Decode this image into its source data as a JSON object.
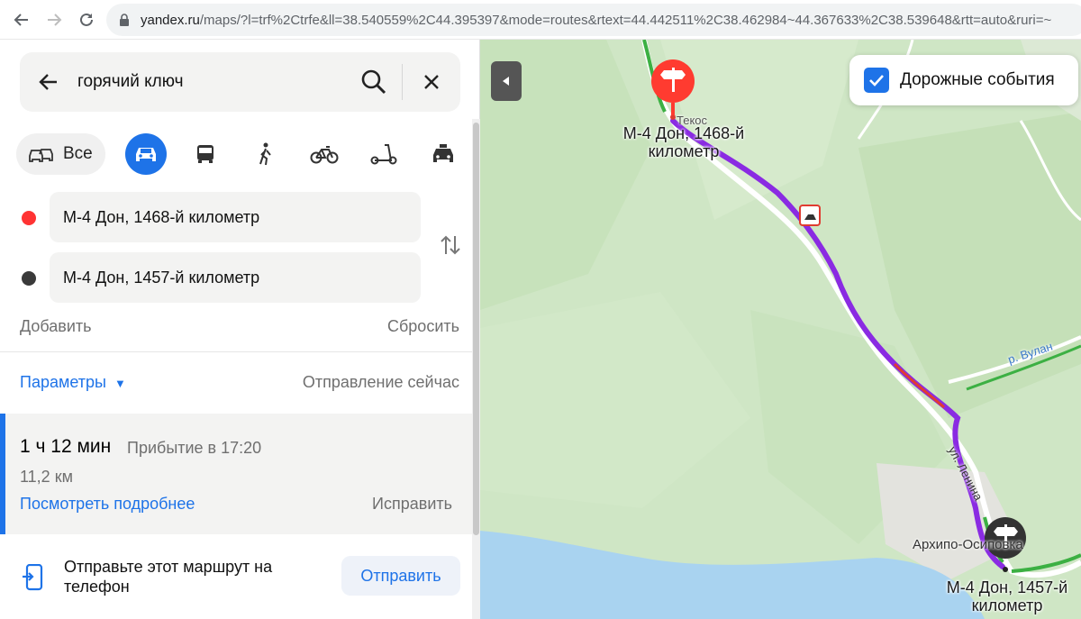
{
  "browser": {
    "url_domain": "yandex.ru",
    "url_rest": "/maps/?l=trf%2Ctrfe&ll=38.540559%2C44.395397&mode=routes&rtext=44.442511%2C38.462984~44.367633%2C38.539648&rtt=auto&ruri=~"
  },
  "search": {
    "query": "горячий ключ"
  },
  "modes": {
    "all_label": "Все",
    "items": [
      "car",
      "bus",
      "walk",
      "bicycle",
      "scooter",
      "taxi"
    ],
    "active": "car"
  },
  "points": {
    "start": "М-4 Дон, 1468-й километр",
    "end": "М-4 Дон, 1457-й километр",
    "start_color": "#ff3333",
    "end_color": "#3a3a3a"
  },
  "actions": {
    "add": "Добавить",
    "reset": "Сбросить"
  },
  "params": {
    "label": "Параметры",
    "departure": "Отправление сейчас"
  },
  "route": {
    "duration": "1 ч 12 мин",
    "arrival": "Прибытие в 17:20",
    "distance": "11,2 км",
    "details": "Посмотреть подробнее",
    "fix": "Исправить"
  },
  "send": {
    "text": "Отправьте этот маршрут на телефон",
    "button": "Отправить"
  },
  "map": {
    "traffic_label": "Дорожные события",
    "traffic_checked": true,
    "start_label": "М-4 Дон, 1468-й километр",
    "end_label": "М-4 Дон, 1457-й километр",
    "town_top": "Текос",
    "town_bottom": "Архипо-Осиповка",
    "river": "р. Вулан",
    "street": "ул. Ленина",
    "route_color": "#8a2be2",
    "accent": "#1e73e8"
  }
}
